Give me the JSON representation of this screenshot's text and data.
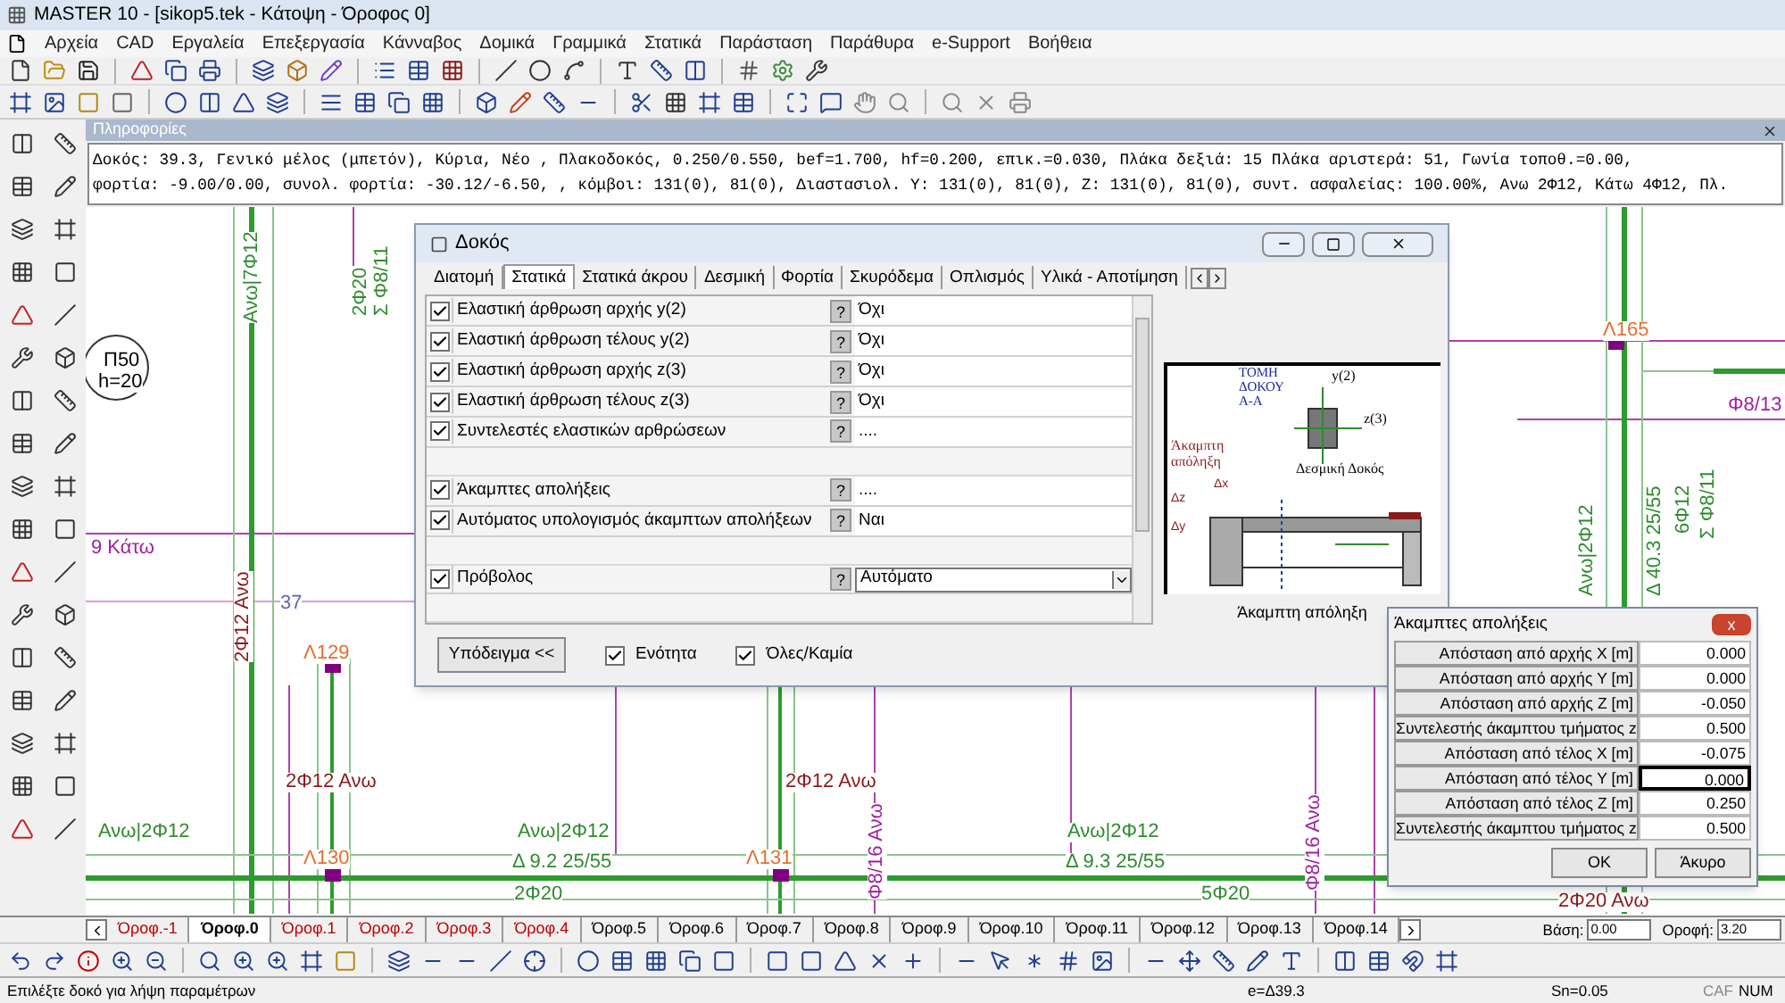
{
  "window": {
    "title": "MASTER 10 - [sikop5.tek - Κάτοψη - Όροφος 0]"
  },
  "menu": [
    "Αρχεία",
    "CAD",
    "Εργαλεία",
    "Επεξεργασία",
    "Κάνναβος",
    "Δομικά",
    "Γραμμικά",
    "Στατικά",
    "Παράσταση",
    "Παράθυρα",
    "e-Support",
    "Βοήθεια"
  ],
  "info_panel": {
    "title": "Πληροφορίες",
    "lines": [
      "Δοκός: 39.3, Γενικό μέλος (μπετόν), Κύρια, Νέο , Πλακοδοκός, 0.250/0.550, bef=1.700, hf=0.200, επικ.=0.030, Πλάκα δεξιά: 15 Πλάκα αριστερά: 51, Γωνία τοποθ.=0.00,",
      "φορτία: -9.00/0.00, συνολ. φορτία: -30.12/-6.50, , κόμβοι: 131(0), 81(0), Διαστασιολ. Y: 131(0), 81(0), Z: 131(0), 81(0), συντ. ασφαλείας: 100.00%, Ανω 2Φ12, Κάτω 4Φ12, Πλ."
    ]
  },
  "canvas_labels": [
    {
      "text": "Ανω|7Φ12",
      "kind": "vertical",
      "color": "#2e8b2e"
    },
    {
      "text": "2Φ20",
      "kind": "vertical",
      "color": "#2e8b2e"
    },
    {
      "text": "Σ Φ8/11",
      "kind": "vertical",
      "color": "#2e8b2e"
    },
    {
      "text": "Π50",
      "kind": "horizontal",
      "color": "#000000"
    },
    {
      "text": "h=20",
      "kind": "horizontal",
      "color": "#000000"
    },
    {
      "text": "9 Κάτω",
      "kind": "horizontal",
      "color": "#a020a0"
    },
    {
      "text": "2Φ12 Ανω",
      "kind": "vertical",
      "color": "#8b1a1a"
    },
    {
      "text": "37",
      "kind": "horizontal",
      "color": "#6060c0"
    },
    {
      "text": "Λ129",
      "kind": "horizontal",
      "color": "#e07030"
    },
    {
      "text": "2Φ12 Ανω",
      "kind": "horizontal",
      "color": "#8b1a1a"
    },
    {
      "text": "Λ130",
      "kind": "horizontal",
      "color": "#e07030"
    },
    {
      "text": "Ανω|2Φ12",
      "kind": "horizontal",
      "color": "#2e8b2e"
    },
    {
      "text": "Ανω|2Φ12",
      "kind": "horizontal",
      "color": "#2e8b2e"
    },
    {
      "text": "Δ 9.2  25/55",
      "kind": "horizontal",
      "color": "#2e8b2e"
    },
    {
      "text": "2Φ12 Ανω",
      "kind": "horizontal",
      "color": "#8b1a1a"
    },
    {
      "text": "Λ131",
      "kind": "horizontal",
      "color": "#e07030"
    },
    {
      "text": "Φ8/16 Ανω",
      "kind": "vertical",
      "color": "#a020a0"
    },
    {
      "text": "2Φ20",
      "kind": "horizontal",
      "color": "#2e8b2e"
    },
    {
      "text": "Ανω|2Φ12",
      "kind": "horizontal",
      "color": "#2e8b2e"
    },
    {
      "text": "Δ 9.3  25/55",
      "kind": "horizontal",
      "color": "#2e8b2e"
    },
    {
      "text": "5Φ20",
      "kind": "horizontal",
      "color": "#2e8b2e"
    },
    {
      "text": "Φ8/16 Ανω",
      "kind": "vertical",
      "color": "#a020a0"
    },
    {
      "text": "2Φ20 Ανω",
      "kind": "horizontal",
      "color": "#8b1a1a"
    },
    {
      "text": "Λ165",
      "kind": "horizontal",
      "color": "#e07030"
    },
    {
      "text": "Φ8/13",
      "kind": "horizontal",
      "color": "#a020a0"
    },
    {
      "text": "Ανω|2Φ12",
      "kind": "vertical",
      "color": "#2e8b2e"
    },
    {
      "text": "Δ 40.3  25/55",
      "kind": "vertical",
      "color": "#2e8b2e"
    },
    {
      "text": "6Φ12",
      "kind": "vertical",
      "color": "#2e8b2e"
    },
    {
      "text": "Σ Φ8/11",
      "kind": "vertical",
      "color": "#2e8b2e"
    }
  ],
  "beam_dialog": {
    "title": "Δοκός",
    "tabs": [
      {
        "label": "Διατομή",
        "selected": false
      },
      {
        "label": "Στατικά",
        "selected": true
      },
      {
        "label": "Στατικά άκρου",
        "selected": false
      },
      {
        "label": "Δεσμική",
        "selected": false
      },
      {
        "label": "Φορτία",
        "selected": false
      },
      {
        "label": "Σκυρόδεμα",
        "selected": false
      },
      {
        "label": "Οπλισμός",
        "selected": false
      },
      {
        "label": "Υλικά - Αποτίμηση",
        "selected": false
      }
    ],
    "rows": [
      {
        "kind": "field",
        "checked": true,
        "label": "Ελαστική άρθρωση αρχής y(2)",
        "help": "?",
        "value": "Όχι"
      },
      {
        "kind": "field",
        "checked": true,
        "label": "Ελαστική άρθρωση τέλους y(2)",
        "help": "?",
        "value": "Όχι"
      },
      {
        "kind": "field",
        "checked": true,
        "label": "Ελαστική άρθρωση αρχής z(3)",
        "help": "?",
        "value": "Όχι"
      },
      {
        "kind": "field",
        "checked": true,
        "label": "Ελαστική άρθρωση τέλους z(3)",
        "help": "?",
        "value": "Όχι"
      },
      {
        "kind": "field",
        "checked": true,
        "label": "Συντελεστές ελαστικών αρθρώσεων",
        "help": "?",
        "value": "...."
      },
      {
        "kind": "spacer"
      },
      {
        "kind": "field",
        "checked": true,
        "label": "Άκαμπτες απολήξεις",
        "help": "?",
        "value": "...."
      },
      {
        "kind": "field",
        "checked": true,
        "label": "Αυτόματος υπολογισμός άκαμπτων απολήξεων",
        "help": "?",
        "value": "Ναι"
      },
      {
        "kind": "spacer"
      },
      {
        "kind": "dropdown",
        "checked": true,
        "label": "Πρόβολος",
        "help": "?",
        "value": "Αυτόματο"
      },
      {
        "kind": "spacer"
      }
    ],
    "diagram": {
      "section_title": [
        "ΤΟΜΗ",
        "ΔΟΚΟΥ",
        "Α-Α"
      ],
      "y_axis": "y(2)",
      "z_axis": "z(3)",
      "rigid_end": [
        "Άκαμπτη",
        "απόληξη"
      ],
      "tie_beam": "Δεσμική Δοκός",
      "dx": "Δx",
      "dz": "Δz",
      "dy": "Δy",
      "caption": "Άκαμπτη απόληξη"
    },
    "example_button": "Υπόδειγμα <<",
    "options": [
      {
        "label": "Ενότητα",
        "checked": true
      },
      {
        "label": "Όλες/Καμία",
        "checked": true
      }
    ]
  },
  "rigid_ends_dialog": {
    "title": "Άκαμπτες απολήξεις",
    "close": "x",
    "rows": [
      {
        "label": "Απόσταση από αρχής X [m]",
        "value": "0.000",
        "selected": false
      },
      {
        "label": "Απόσταση από αρχής Y [m]",
        "value": "0.000",
        "selected": false
      },
      {
        "label": "Απόσταση από αρχής Z [m]",
        "value": "-0.050",
        "selected": false
      },
      {
        "label": "Συντελεστής άκαμπτου τμήματος z",
        "value": "0.500",
        "selected": false
      },
      {
        "label": "Απόσταση από τέλος X [m]",
        "value": "-0.075",
        "selected": false
      },
      {
        "label": "Απόσταση από τέλος Y [m]",
        "value": "0.000",
        "selected": true
      },
      {
        "label": "Απόσταση από τέλος Z [m]",
        "value": "0.250",
        "selected": false
      },
      {
        "label": "Συντελεστής άκαμπτου τμήματος z",
        "value": "0.500",
        "selected": false
      }
    ],
    "buttons": [
      "OK",
      "Άκυρο"
    ]
  },
  "floor_tabs": [
    {
      "label": "Όροφ.-1",
      "selected": false,
      "color": "#c00000"
    },
    {
      "label": "Όροφ.0",
      "selected": true,
      "color": "#000000"
    },
    {
      "label": "Όροφ.1",
      "selected": false,
      "color": "#c00000"
    },
    {
      "label": "Όροφ.2",
      "selected": false,
      "color": "#c00000"
    },
    {
      "label": "Όροφ.3",
      "selected": false,
      "color": "#c00000"
    },
    {
      "label": "Όροφ.4",
      "selected": false,
      "color": "#c00000"
    },
    {
      "label": "Όροφ.5",
      "selected": false,
      "color": "#000000"
    },
    {
      "label": "Όροφ.6",
      "selected": false,
      "color": "#000000"
    },
    {
      "label": "Όροφ.7",
      "selected": false,
      "color": "#000000"
    },
    {
      "label": "Όροφ.8",
      "selected": false,
      "color": "#000000"
    },
    {
      "label": "Όροφ.9",
      "selected": false,
      "color": "#000000"
    },
    {
      "label": "Όροφ.10",
      "selected": false,
      "color": "#000000"
    },
    {
      "label": "Όροφ.11",
      "selected": false,
      "color": "#000000"
    },
    {
      "label": "Όροφ.12",
      "selected": false,
      "color": "#000000"
    },
    {
      "label": "Όροφ.13",
      "selected": false,
      "color": "#000000"
    },
    {
      "label": "Όροφ.14",
      "selected": false,
      "color": "#000000"
    }
  ],
  "base": {
    "label": "Βάση:",
    "value": "0.00"
  },
  "roof": {
    "label": "Οροφή:",
    "value": "3.20"
  },
  "status_bar": {
    "message": "Επιλέξτε δοκό για λήψη παραμέτρων",
    "coordinate": "e=Δ39.3",
    "snap": "Sn=0.05",
    "caf": "CAF",
    "num": "NUM"
  }
}
